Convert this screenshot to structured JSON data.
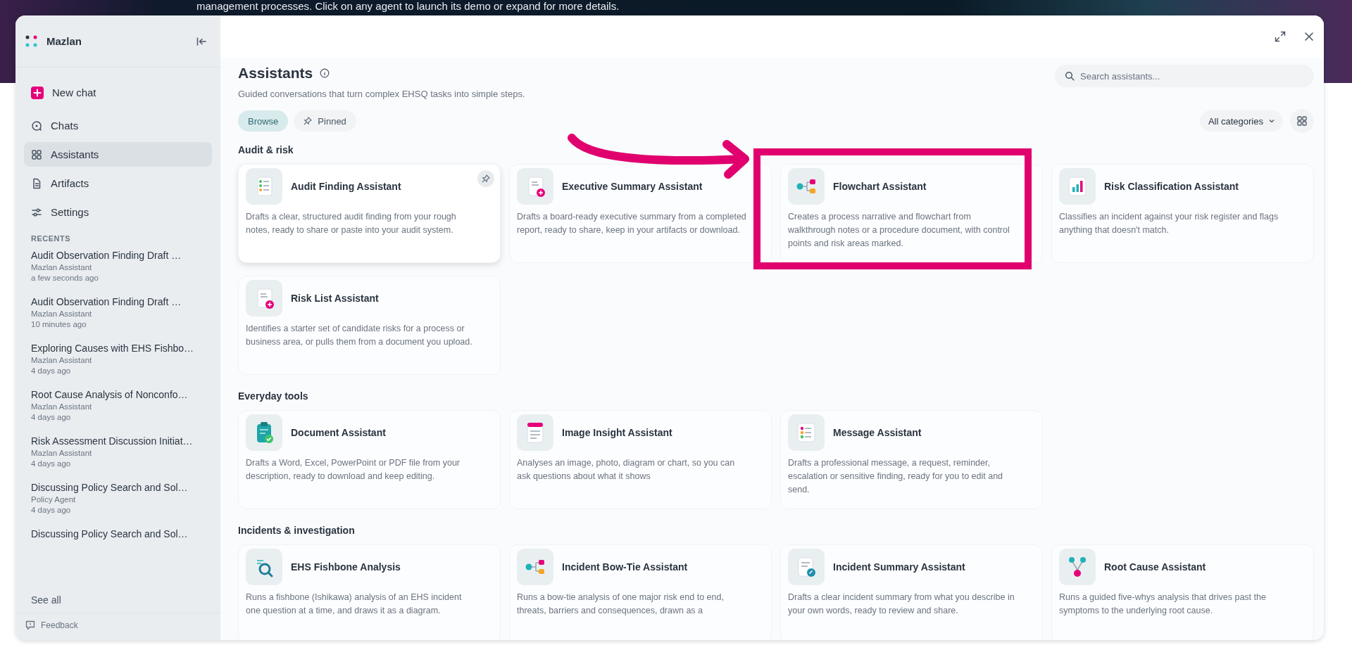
{
  "banner": {
    "text": "management processes. Click on any agent to launch its demo or expand for more details."
  },
  "sidebar": {
    "brand": "Mazlan",
    "new_chat": "New chat",
    "items": [
      {
        "label": "Chats",
        "selected": false
      },
      {
        "label": "Assistants",
        "selected": true
      },
      {
        "label": "Artifacts",
        "selected": false
      },
      {
        "label": "Settings",
        "selected": false
      }
    ],
    "recents_heading": "RECENTS",
    "recents": [
      {
        "title": "Audit Observation Finding Draft …",
        "agent": "Mazlan Assistant",
        "time": "a few seconds ago"
      },
      {
        "title": "Audit Observation Finding Draft …",
        "agent": "Mazlan Assistant",
        "time": "10 minutes ago"
      },
      {
        "title": "Exploring Causes with EHS Fishbo…",
        "agent": "Mazlan Assistant",
        "time": "4 days ago"
      },
      {
        "title": "Root Cause Analysis of Nonconfo…",
        "agent": "Mazlan Assistant",
        "time": "4 days ago"
      },
      {
        "title": "Risk Assessment Discussion Initiat…",
        "agent": "Mazlan Assistant",
        "time": "4 days ago"
      },
      {
        "title": "Discussing Policy Search and Sol…",
        "agent": "Policy Agent",
        "time": "4 days ago"
      },
      {
        "title": "Discussing Policy Search and Sol…"
      }
    ],
    "see_all": "See all",
    "feedback": "Feedback"
  },
  "main": {
    "title": "Assistants",
    "subtitle": "Guided conversations that turn complex EHSQ tasks into simple steps.",
    "tabs": [
      {
        "label": "Browse",
        "selected": true
      },
      {
        "label": "Pinned",
        "selected": false
      }
    ],
    "search": {
      "placeholder": "Search assistants..."
    },
    "category_filter": "All categories",
    "sections": [
      {
        "heading": "Audit & risk",
        "cards": [
          {
            "title": "Audit Finding Assistant",
            "description": "Drafts a clear, structured audit finding from your rough notes, ready to share or paste into your audit system.",
            "hovered": true,
            "highlighted": false
          },
          {
            "title": "Executive Summary Assistant",
            "description": "Drafts a board-ready executive summary from a completed report, ready to share, keep in your artifacts or download.",
            "hovered": false,
            "highlighted": false
          },
          {
            "title": "Flowchart Assistant",
            "description": "Creates a process narrative and flowchart from walkthrough notes or a procedure document, with control points and risk areas marked.",
            "hovered": false,
            "highlighted": true
          },
          {
            "title": "Risk Classification Assistant",
            "description": "Classifies an incident against your risk register and flags anything that doesn't match.",
            "hovered": false,
            "highlighted": false
          },
          {
            "title": "Risk List Assistant",
            "description": "Identifies a starter set of candidate risks for a process or business area, or pulls them from a document you upload.",
            "hovered": false,
            "highlighted": false
          }
        ]
      },
      {
        "heading": "Everyday tools",
        "cards": [
          {
            "title": "Document Assistant",
            "description": "Drafts a Word, Excel, PowerPoint or PDF file from your description, ready to download and keep editing.",
            "hovered": false,
            "highlighted": false
          },
          {
            "title": "Image Insight Assistant",
            "description": "Analyses an image, photo, diagram or chart, so you can ask questions about what it shows",
            "hovered": false,
            "highlighted": false
          },
          {
            "title": "Message Assistant",
            "description": "Drafts a professional message, a request, reminder, escalation or sensitive finding, ready for you to edit and send.",
            "hovered": false,
            "highlighted": false
          }
        ]
      },
      {
        "heading": "Incidents & investigation",
        "cards": [
          {
            "title": "EHS Fishbone Analysis",
            "description": "Runs a fishbone (Ishikawa) analysis of an EHS incident one question at a time, and draws it as a diagram.",
            "hovered": false,
            "highlighted": false
          },
          {
            "title": "Incident Bow-Tie Assistant",
            "description": "Runs a bow-tie analysis of one major risk end to end, threats, barriers and consequences, drawn as a",
            "hovered": false,
            "highlighted": false
          },
          {
            "title": "Incident Summary Assistant",
            "description": "Drafts a clear incident summary from what you describe in your own words, ready to review and share.",
            "hovered": false,
            "highlighted": false
          },
          {
            "title": "Root Cause Assistant",
            "description": "Runs a guided five-whys analysis that drives past the symptoms to the underlying root cause.",
            "hovered": false,
            "highlighted": false
          }
        ]
      }
    ]
  },
  "annotations": [
    {
      "kind": "arrow"
    }
  ]
}
